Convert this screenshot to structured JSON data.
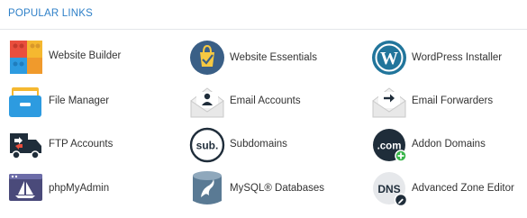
{
  "panel": {
    "title": "POPULAR LINKS"
  },
  "links": [
    {
      "label": "Website Builder",
      "icon": "website-builder-icon"
    },
    {
      "label": "Website Essentials",
      "icon": "website-essentials-icon"
    },
    {
      "label": "WordPress Installer",
      "icon": "wordpress-icon"
    },
    {
      "label": "File Manager",
      "icon": "file-manager-icon"
    },
    {
      "label": "Email Accounts",
      "icon": "email-accounts-icon"
    },
    {
      "label": "Email Forwarders",
      "icon": "email-forwarders-icon"
    },
    {
      "label": "FTP Accounts",
      "icon": "ftp-accounts-icon"
    },
    {
      "label": "Subdomains",
      "icon": "subdomains-icon",
      "icon_text": "sub."
    },
    {
      "label": "Addon Domains",
      "icon": "addon-domains-icon",
      "icon_text": ".com"
    },
    {
      "label": "phpMyAdmin",
      "icon": "phpmyadmin-icon"
    },
    {
      "label": "MySQL® Databases",
      "icon": "mysql-databases-icon"
    },
    {
      "label": "Advanced Zone Editor",
      "icon": "advanced-zone-editor-icon",
      "icon_text": "DNS"
    }
  ],
  "colors": {
    "title": "#2f80c8",
    "text": "#333333",
    "wordpress_blue": "#21759b",
    "dark_icon": "#1f2d3a",
    "folder_blue": "#2d9be0",
    "folder_yellow": "#f5b830",
    "green_badge": "#39b54a"
  }
}
